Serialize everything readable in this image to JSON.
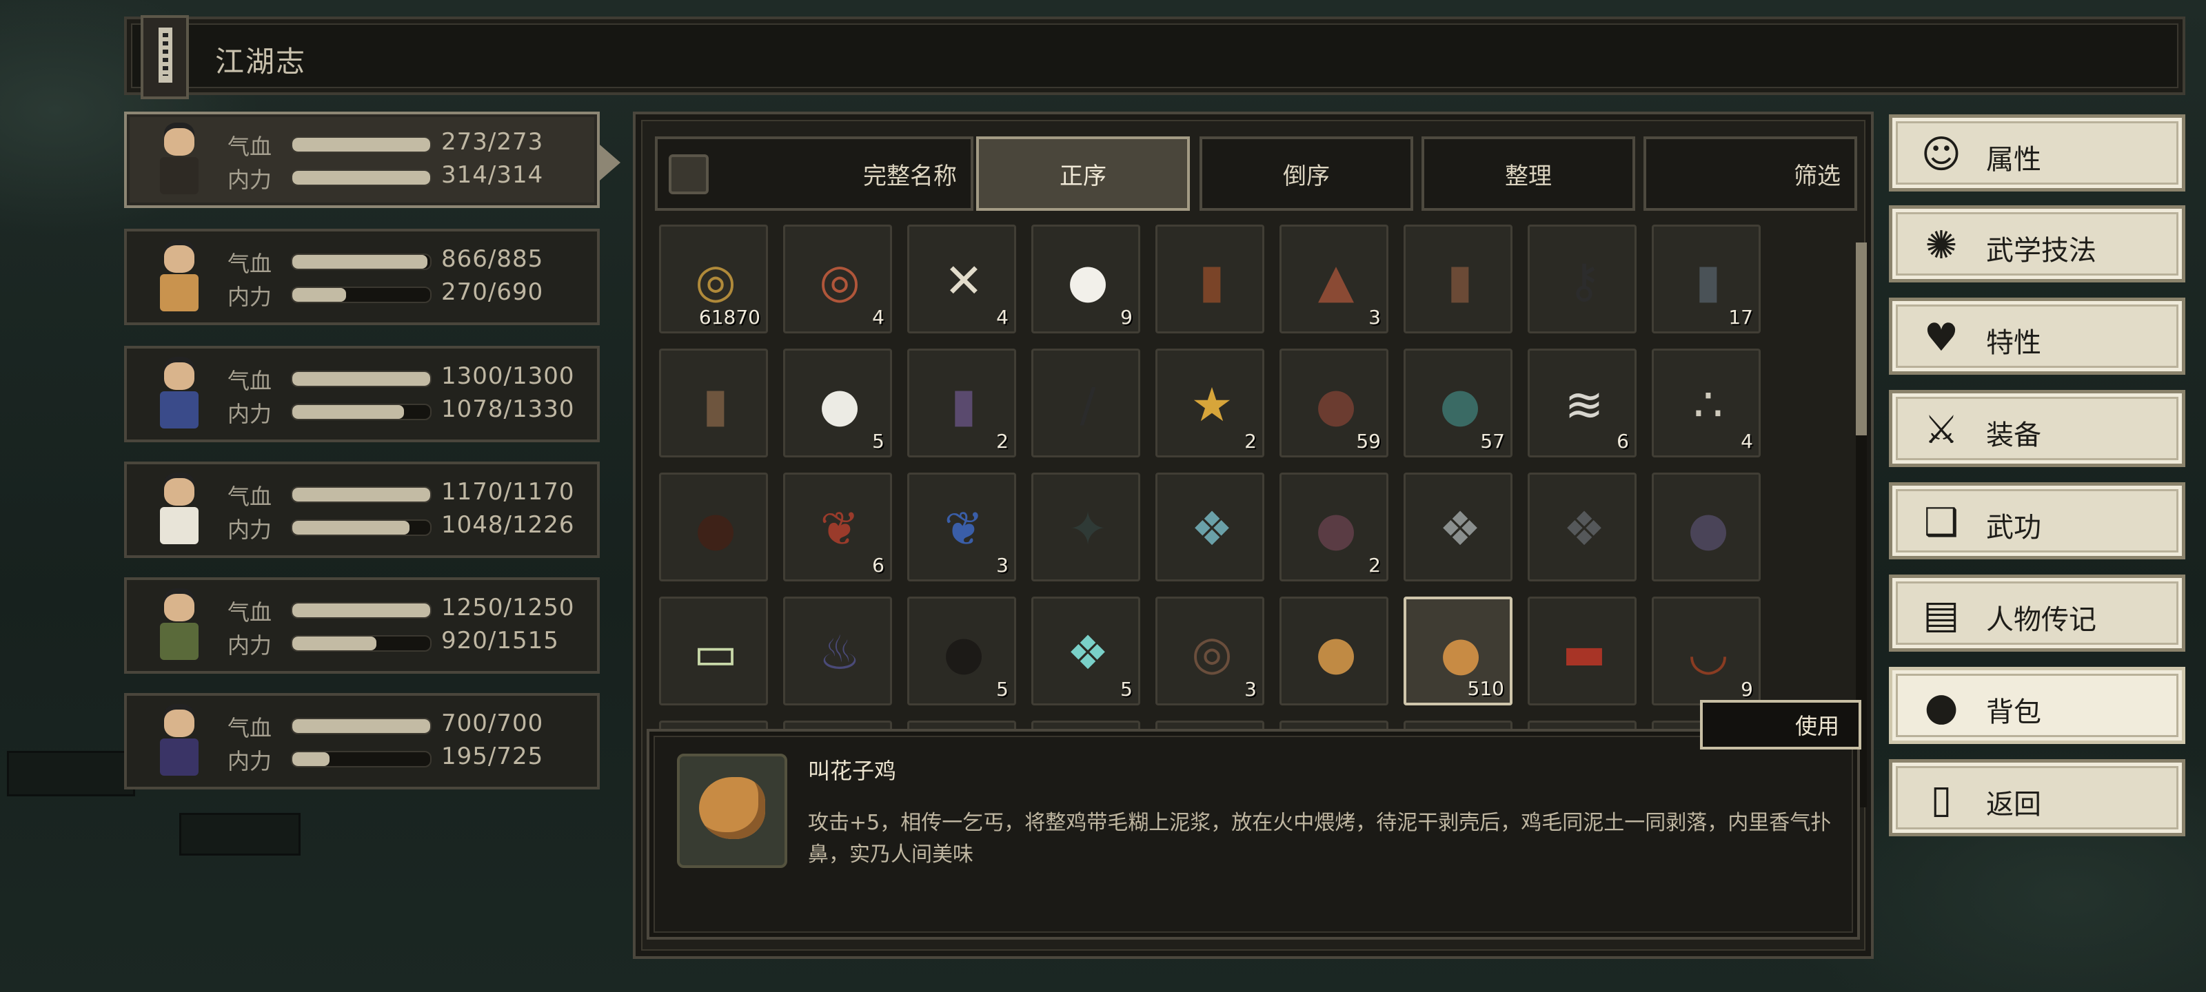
{
  "title": "江湖志",
  "labels": {
    "hp": "气血",
    "mp": "内力"
  },
  "party": [
    {
      "hp": "273/273",
      "mp": "314/314",
      "hp_frac": 1.0,
      "mp_frac": 1.0,
      "selected": true
    },
    {
      "hp": "866/885",
      "mp": "270/690",
      "hp_frac": 0.98,
      "mp_frac": 0.39,
      "selected": false
    },
    {
      "hp": "1300/1300",
      "mp": "1078/1330",
      "hp_frac": 1.0,
      "mp_frac": 0.81,
      "selected": false
    },
    {
      "hp": "1170/1170",
      "mp": "1048/1226",
      "hp_frac": 1.0,
      "mp_frac": 0.85,
      "selected": false
    },
    {
      "hp": "1250/1250",
      "mp": "920/1515",
      "hp_frac": 1.0,
      "mp_frac": 0.61,
      "selected": false
    },
    {
      "hp": "700/700",
      "mp": "195/725",
      "hp_frac": 1.0,
      "mp_frac": 0.27,
      "selected": false
    }
  ],
  "tabs": {
    "full_name": "完整名称",
    "asc": "正序",
    "desc": "倒序",
    "sort": "整理",
    "filter": "筛选"
  },
  "items": [
    {
      "icon": "coin-string-icon",
      "glyph": "◎",
      "color": "#b08a3a",
      "count": "61870"
    },
    {
      "icon": "copper-coins-icon",
      "glyph": "◎",
      "color": "#b0563a",
      "count": "4"
    },
    {
      "icon": "bone-icon",
      "glyph": "✕",
      "color": "#e2dccb",
      "count": "4"
    },
    {
      "icon": "rice-balls-icon",
      "glyph": "●",
      "color": "#f2f0ea",
      "count": "9"
    },
    {
      "icon": "jar-icon",
      "glyph": "▮",
      "color": "#7a4428",
      "count": ""
    },
    {
      "icon": "cake-icon",
      "glyph": "▲",
      "color": "#8a4a34",
      "count": "3"
    },
    {
      "icon": "pot-icon",
      "glyph": "▮",
      "color": "#6b4a36",
      "count": ""
    },
    {
      "icon": "key-icon",
      "glyph": "⚷",
      "color": "#2c2c2c",
      "count": ""
    },
    {
      "icon": "bucket-icon",
      "glyph": "▮",
      "color": "#4a5257",
      "count": "17"
    },
    {
      "icon": "drum-icon",
      "glyph": "▮",
      "color": "#6e553e",
      "count": ""
    },
    {
      "icon": "steamed-bun-icon",
      "glyph": "●",
      "color": "#ecebe4",
      "count": "5"
    },
    {
      "icon": "ink-jar-icon",
      "glyph": "▮",
      "color": "#5a4a6e",
      "count": "2"
    },
    {
      "icon": "spear-icon",
      "glyph": "/",
      "color": "#2b2b2b",
      "count": ""
    },
    {
      "icon": "map-scroll-icon",
      "glyph": "★",
      "color": "#d7a53a",
      "count": "2"
    },
    {
      "icon": "ore-icon",
      "glyph": "●",
      "color": "#6b3c30",
      "count": "59"
    },
    {
      "icon": "jade-stone-icon",
      "glyph": "●",
      "color": "#3a6a64",
      "count": "57"
    },
    {
      "icon": "feathers-icon",
      "glyph": "≋",
      "color": "#d8d6cf",
      "count": "6"
    },
    {
      "icon": "pebbles-icon",
      "glyph": "∴",
      "color": "#cfcabc",
      "count": "4"
    },
    {
      "icon": "wine-jar-icon",
      "glyph": "●",
      "color": "#3e2218",
      "count": ""
    },
    {
      "icon": "red-herb-icon",
      "glyph": "❦",
      "color": "#9a3b2b",
      "count": "6"
    },
    {
      "icon": "blue-herb-icon",
      "glyph": "❦",
      "color": "#3a5ea8",
      "count": "3"
    },
    {
      "icon": "dark-gem-icon",
      "glyph": "✦",
      "color": "#2f3a36",
      "count": ""
    },
    {
      "icon": "crystal-icon",
      "glyph": "❖",
      "color": "#6aa0a8",
      "count": ""
    },
    {
      "icon": "purple-ore-icon",
      "glyph": "●",
      "color": "#5a3c44",
      "count": "2"
    },
    {
      "icon": "grey-crystal-icon",
      "glyph": "❖",
      "color": "#8a8f8e",
      "count": ""
    },
    {
      "icon": "iron-shards-icon",
      "glyph": "❖",
      "color": "#55585a",
      "count": ""
    },
    {
      "icon": "mesh-stone-icon",
      "glyph": "●",
      "color": "#4a4458",
      "count": ""
    },
    {
      "icon": "banknote-icon",
      "glyph": "▭",
      "color": "#c8d8a8",
      "count": ""
    },
    {
      "icon": "incense-burner-icon",
      "glyph": "♨",
      "color": "#4a4a78",
      "count": ""
    },
    {
      "icon": "black-jar-icon",
      "glyph": "●",
      "color": "#1c1a17",
      "count": "5"
    },
    {
      "icon": "turquoise-icon",
      "glyph": "❖",
      "color": "#7ad0c8",
      "count": "5"
    },
    {
      "icon": "rope-coil-icon",
      "glyph": "◎",
      "color": "#6a4e3c",
      "count": "3"
    },
    {
      "icon": "bread-icon",
      "glyph": "●",
      "color": "#c08a44",
      "count": ""
    },
    {
      "icon": "roast-chicken-icon",
      "glyph": "●",
      "color": "#c88b44",
      "count": "510"
    },
    {
      "icon": "talisman-icon",
      "glyph": "▬",
      "color": "#a83426",
      "count": ""
    },
    {
      "icon": "necklace-icon",
      "glyph": "◡",
      "color": "#8a3c22",
      "count": "9"
    }
  ],
  "selected_index": 33,
  "use_label": "使用",
  "detail": {
    "name": "叫花子鸡",
    "desc": "攻击+5，相传一乞丐，将整鸡带毛糊上泥浆，放在火中煨烤，待泥干剥壳后，鸡毛同泥土一同剥落，内里香气扑鼻，实乃人间美味"
  },
  "menu": [
    {
      "label": "属性",
      "icon": "attributes-icon",
      "glyph": "☺",
      "active": false
    },
    {
      "label": "武学技法",
      "icon": "martial-skills-icon",
      "glyph": "✺",
      "active": false
    },
    {
      "label": "特性",
      "icon": "traits-icon",
      "glyph": "♥",
      "active": false
    },
    {
      "label": "装备",
      "icon": "equipment-icon",
      "glyph": "⚔",
      "active": false
    },
    {
      "label": "武功",
      "icon": "kungfu-book-icon",
      "glyph": "❑",
      "active": false
    },
    {
      "label": "人物传记",
      "icon": "biography-icon",
      "glyph": "▤",
      "active": false
    },
    {
      "label": "背包",
      "icon": "backpack-icon",
      "glyph": "●",
      "active": true
    },
    {
      "label": "返回",
      "icon": "door-icon",
      "glyph": "▯",
      "active": false
    }
  ]
}
